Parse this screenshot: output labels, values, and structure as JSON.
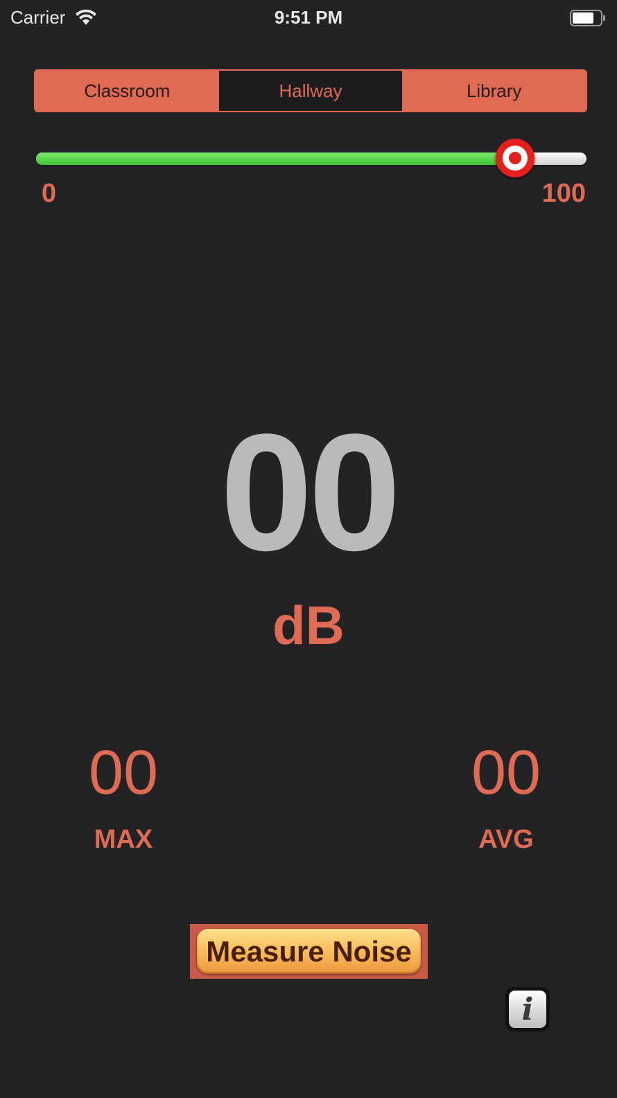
{
  "status_bar": {
    "carrier": "Carrier",
    "time": "9:51 PM",
    "icons": [
      "wifi-icon",
      "battery-icon"
    ]
  },
  "location_selector": {
    "segments": [
      "Classroom",
      "Hallway",
      "Library"
    ],
    "selected": "Hallway"
  },
  "threshold_slider": {
    "min_label": "0",
    "max_label": "100",
    "value_fraction": 0.87,
    "fill_color": "#4cd13f",
    "thumb_color": "#e3201b"
  },
  "meter": {
    "reading": "00",
    "unit": "dB"
  },
  "stats": {
    "max_value": "00",
    "max_label": "MAX",
    "avg_value": "00",
    "avg_label": "AVG"
  },
  "actions": {
    "measure_label": "Measure Noise",
    "info_icon": "info-icon"
  },
  "colors": {
    "accent": "#e06b55",
    "background": "#232326",
    "reading": "#bababa"
  }
}
